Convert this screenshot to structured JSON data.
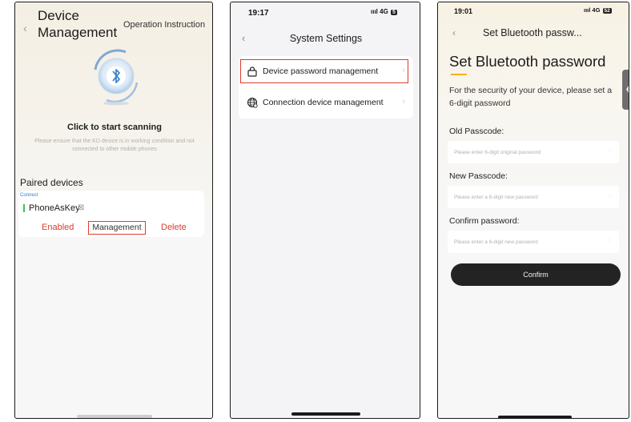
{
  "screen1": {
    "back_glyph": "‹",
    "title": "Device Management",
    "operation_link": "Operation Instruction",
    "scan_title": "Click to start scanning",
    "scan_note": "Please ensure that the KD device is in working condition and not connected to other mobile phones",
    "paired_heading": "Paired devices",
    "connect_status": "Connect",
    "device_name": "PhoneAsKey",
    "edit_glyph": "⊠",
    "actions": {
      "enabled": "Enabled",
      "management": "Management",
      "delete": "Delete"
    },
    "orb_icon": "bluetooth-icon",
    "highlight_color": "#e23a2f"
  },
  "screen2": {
    "time": "19:17",
    "signal": "ıııl 4G",
    "battery": "5",
    "back_glyph": "‹",
    "title": "System Settings",
    "items": [
      {
        "label": "Device password management",
        "icon": "lock-icon",
        "chevron": "›"
      },
      {
        "label": "Connection device management",
        "icon": "globe-icon",
        "chevron": "›"
      }
    ]
  },
  "screen3": {
    "time": "19:01",
    "signal": "ıııl 4G",
    "battery": "52",
    "back_glyph": "‹",
    "nav_title": "Set Bluetooth passw...",
    "title": "Set Bluetooth password",
    "description": "For the security of your device, please set a 6-digit password",
    "side_tab_glyph": "❮",
    "fields": [
      {
        "label": "Old Passcode:",
        "placeholder": "Please enter 6-digit original password"
      },
      {
        "label": "New Passcode:",
        "placeholder": "Please enter a 6-digit new password"
      },
      {
        "label": "Confirm password:",
        "placeholder": "Please enter a 6-digit new password"
      }
    ],
    "eye_glyph": "◌",
    "confirm_label": "Confirm",
    "accent_color": "#f2b320"
  }
}
